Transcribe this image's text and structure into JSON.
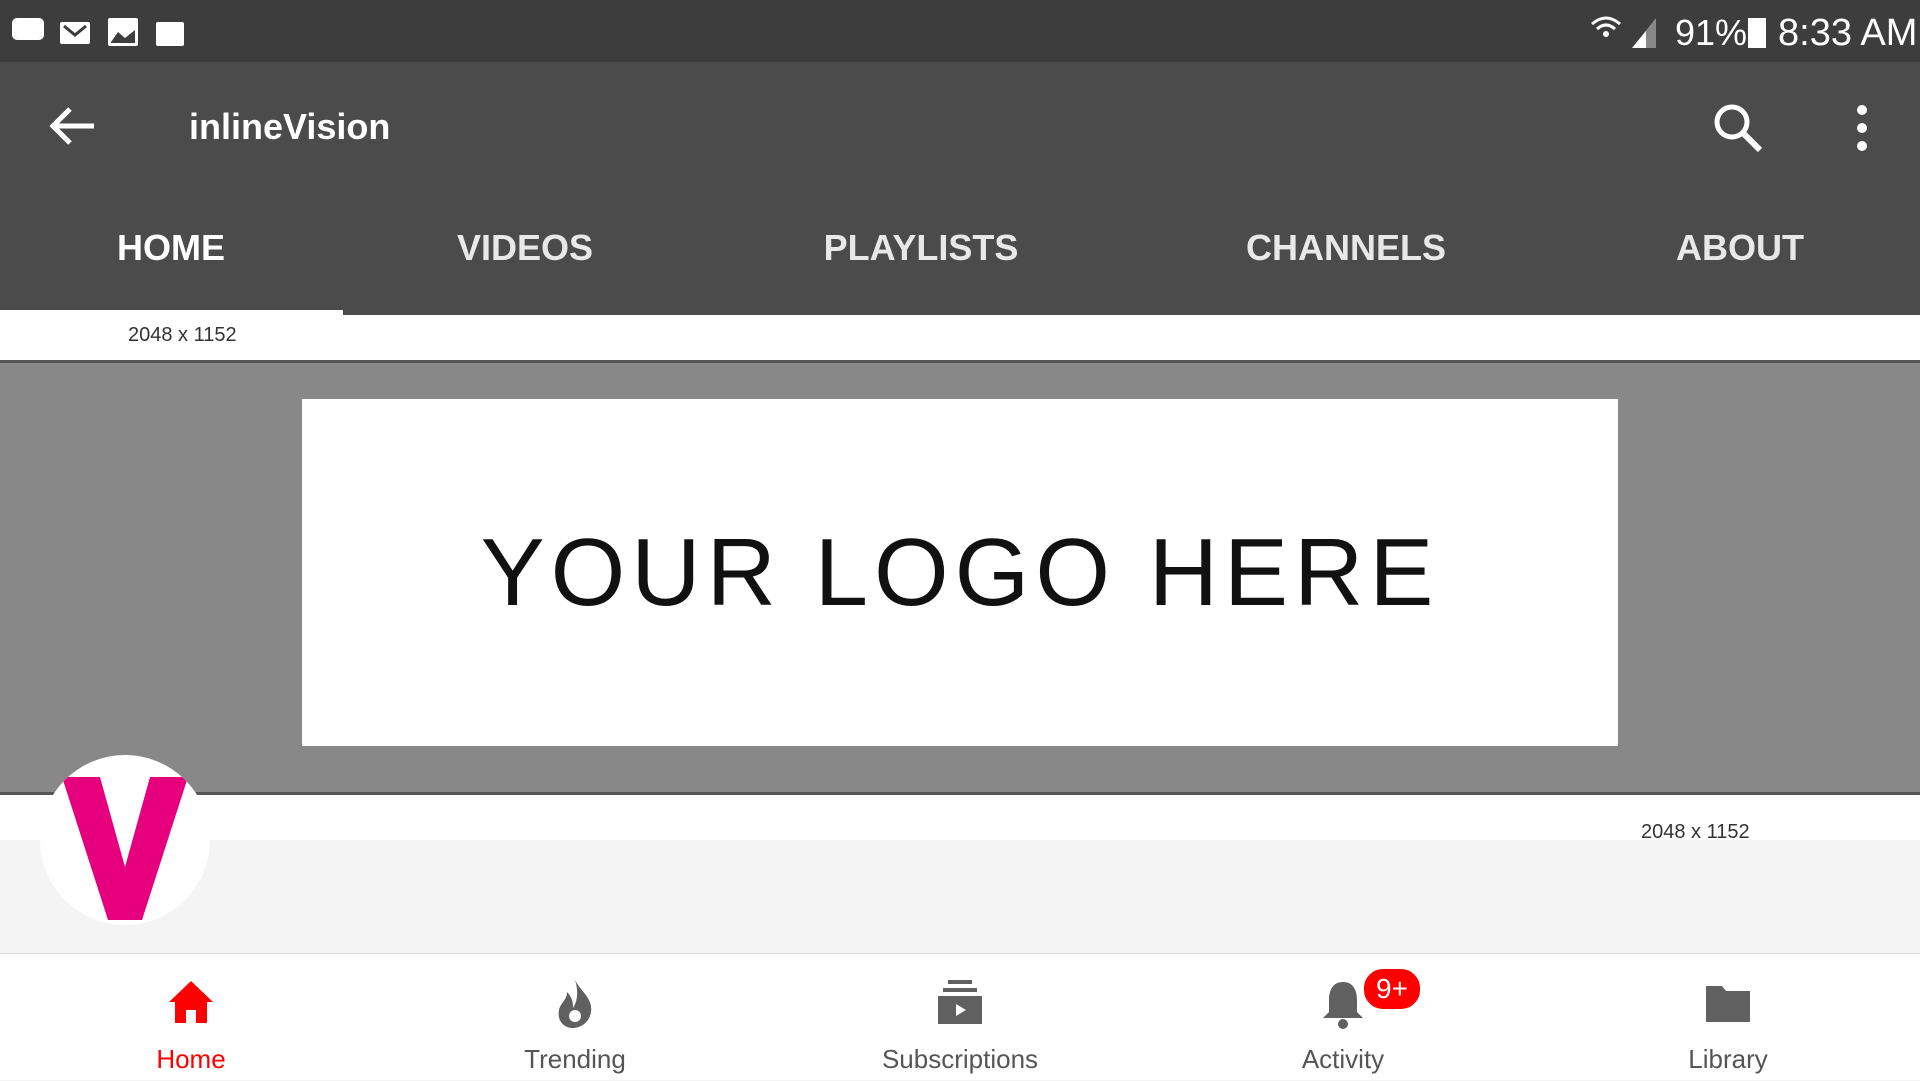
{
  "status_bar": {
    "battery": "91%",
    "time": "8:33 AM",
    "left_icons": [
      "caller-id-icon",
      "mail-icon",
      "image-icon",
      "maps-icon"
    ],
    "right_icons": [
      "wifi-icon",
      "signal-icon",
      "battery-icon"
    ]
  },
  "app_bar": {
    "title": "inlineVision"
  },
  "tabs": [
    {
      "label": "HOME",
      "active": true
    },
    {
      "label": "VIDEOS"
    },
    {
      "label": "PLAYLISTS"
    },
    {
      "label": "CHANNELS"
    },
    {
      "label": "ABOUT"
    }
  ],
  "banner": {
    "dim_top": "2048 x 1152",
    "logo_text": "YOUR LOGO HERE",
    "dim_bottom": "2048 x 1152"
  },
  "avatar": {
    "letter": "V",
    "color": "#e6007e"
  },
  "bottom_nav": [
    {
      "label": "Home",
      "active": true
    },
    {
      "label": "Trending"
    },
    {
      "label": "Subscriptions"
    },
    {
      "label": "Activity",
      "badge": "9+"
    },
    {
      "label": "Library"
    }
  ],
  "colors": {
    "accent": "#ff0000",
    "appbar": "#4b4b4b",
    "statusbar": "#3d3d3d"
  }
}
